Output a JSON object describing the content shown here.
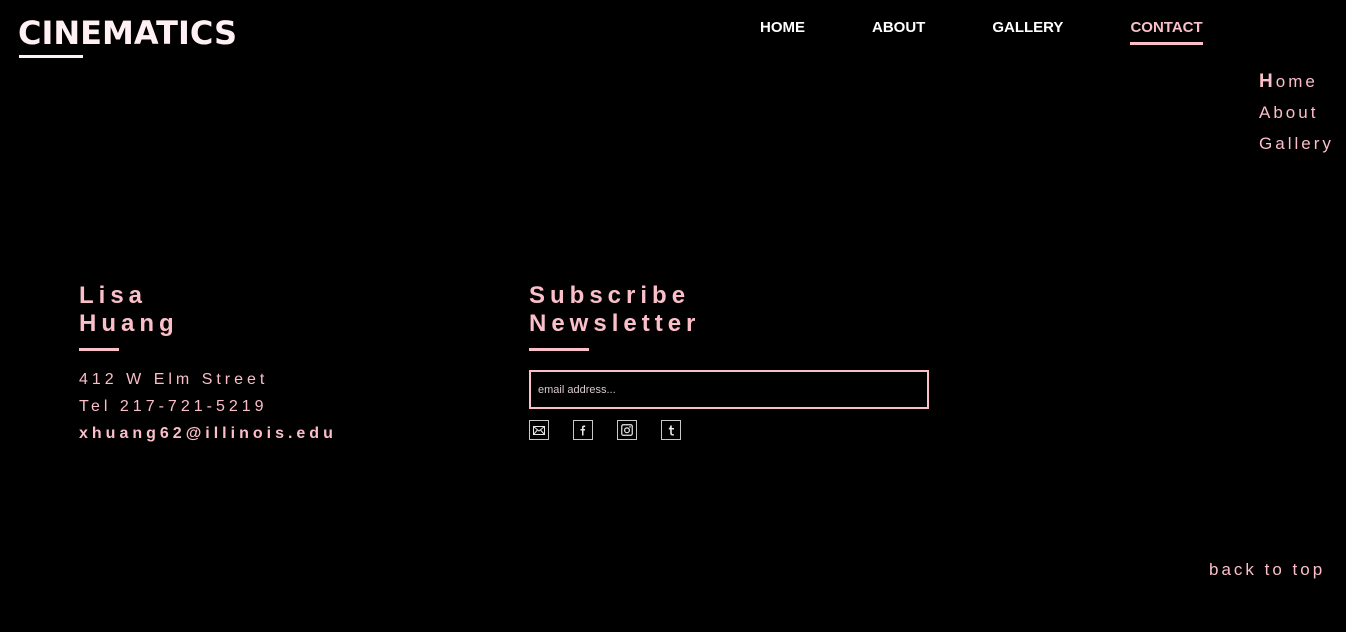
{
  "brand": {
    "logo": "CINEMATICS"
  },
  "topnav": {
    "items": [
      {
        "label": "HOME"
      },
      {
        "label": "ABOUT"
      },
      {
        "label": "GALLERY"
      },
      {
        "label": "CONTACT"
      }
    ],
    "active": "CONTACT"
  },
  "sidenav": {
    "items": [
      {
        "first": "H",
        "rest": "ome"
      },
      {
        "first": "A",
        "rest": "bout"
      },
      {
        "first": "G",
        "rest": "allery"
      }
    ]
  },
  "contact": {
    "first_name": "Lisa",
    "last_name": "Huang",
    "address": "412 W Elm Street",
    "phone": "Tel 217-721-5219",
    "email": "xhuang62@illinois.edu"
  },
  "subscribe": {
    "heading_line1": "Subscribe",
    "heading_line2": "Newsletter",
    "email_placeholder": "email address...",
    "social_icons": [
      "mail-icon",
      "facebook-icon",
      "instagram-icon",
      "tumblr-icon"
    ]
  },
  "footer": {
    "back_to_top": "back to top"
  },
  "colors": {
    "background": "#000000",
    "accent_pink": "#fbbfca",
    "logo_white": "#fff1f3"
  }
}
